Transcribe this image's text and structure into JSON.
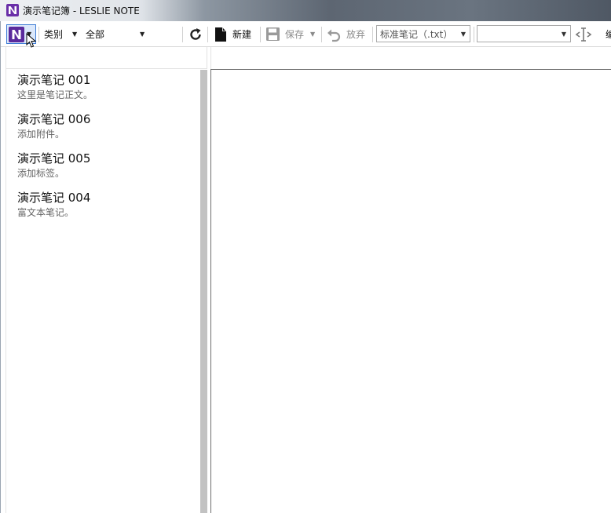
{
  "window": {
    "title": "演示笔记簿 - LESLIE NOTE"
  },
  "toolbar": {
    "category_label": "类别",
    "category_value": "全部",
    "new_label": "新建",
    "save_label": "保存",
    "discard_label": "放弃",
    "note_type_value": "标准笔记（.txt）",
    "extra_combo_value": "",
    "edge_label": "编"
  },
  "notes": [
    {
      "title": "演示笔记 001",
      "summary": "这里是笔记正文。"
    },
    {
      "title": "演示笔记 006",
      "summary": "添加附件。"
    },
    {
      "title": "演示笔记 005",
      "summary": "添加标签。"
    },
    {
      "title": "演示笔记 004",
      "summary": "富文本笔记。"
    }
  ],
  "colors": {
    "brand": "#5a2a9c",
    "selection": "#dbe8fb",
    "accent": "#3d7bd4"
  }
}
